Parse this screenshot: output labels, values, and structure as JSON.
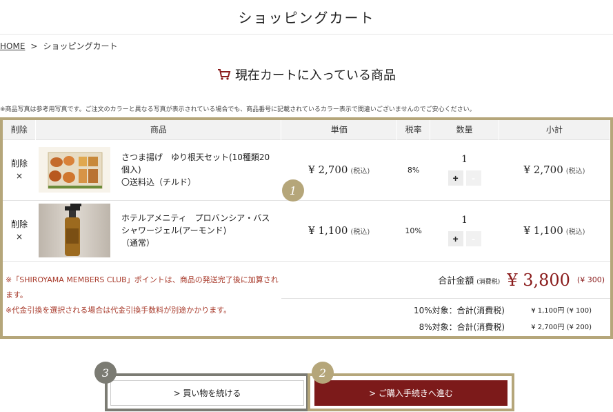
{
  "header": {
    "title": "ショッピングカート"
  },
  "breadcrumb": {
    "home": "HOME",
    "sep": ">",
    "current": "ショッピングカート"
  },
  "section": {
    "title": "現在カートに入っている商品",
    "icon": "cart-icon"
  },
  "notice": "※商品写真は参考用写真です。ご注文のカラーと異なる写真が表示されている場合でも、商品番号に記載されているカラー表示で間違いございませんのでご安心ください。",
  "table": {
    "headers": [
      "削除",
      "商品",
      "単価",
      "税率",
      "数量",
      "小計"
    ],
    "rows": [
      {
        "delete_label": "削除",
        "delete_mark": "×",
        "name_line1": "さつま揚げ　ゆり根天セット(10種類20",
        "name_line2": "個入)",
        "name_line3": "〇送料込（チルド）",
        "price": "¥ 2,700",
        "price_note": "(税込)",
        "tax": "8%",
        "qty": "1",
        "subtotal": "¥ 2,700",
        "subtotal_note": "(税込)"
      },
      {
        "delete_label": "削除",
        "delete_mark": "×",
        "name_line1": "ホテルアメニティ　プロバンシア・バス",
        "name_line2": "シャワージェル(アーモンド)",
        "name_line3": "（通常）",
        "price": "¥ 1,100",
        "price_note": "(税込)",
        "tax": "10%",
        "qty": "1",
        "subtotal": "¥ 1,100",
        "subtotal_note": "(税込)"
      }
    ],
    "qty_plus": "+",
    "qty_minus": "-"
  },
  "notes": {
    "line1": "※「SHIROYAMA MEMBERS CLUB」ポイントは、商品の発送完了後に加算されます。",
    "line2": "※代金引換を選択される場合は代金引換手数料が別途かかります。"
  },
  "totals": {
    "label": "合計金額",
    "label_note": "(消費税)",
    "amount": "¥ 3,800",
    "tax_amount": "(¥ 300)",
    "tax10_label": "10%対象：合計(消費税)",
    "tax10_value": "¥ 1,100円 (¥ 100)",
    "tax8_label": "8%対象：合計(消費税)",
    "tax8_value": "¥ 2,700円 (¥ 200)"
  },
  "badges": {
    "b1": "1",
    "b2": "2",
    "b3": "3"
  },
  "buttons": {
    "continue": "> 買い物を続ける",
    "checkout": "> ご購入手続きへ進む"
  },
  "colors": {
    "accent_gold": "#b5a67a",
    "brand_red": "#7c1a1a",
    "gray_frame": "#7b7b73"
  }
}
